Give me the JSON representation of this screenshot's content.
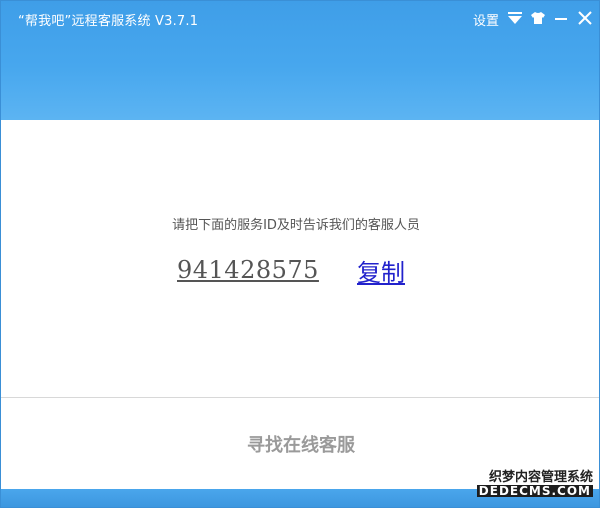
{
  "window": {
    "title": "“帮我吧”远程客服系统 V3.7.1",
    "settings_label": "设置",
    "controls": [
      "menu-dropdown-icon",
      "skin-shirt-icon",
      "minimize-icon",
      "close-icon"
    ]
  },
  "main": {
    "instruction": "请把下面的服务ID及时告诉我们的客服人员",
    "service_id": "941428575",
    "copy_label": "复制"
  },
  "footer": {
    "find_service": "寻找在线客服"
  },
  "watermark": {
    "line1": "织梦内容管理系统",
    "line2": "DEDECMS.COM"
  },
  "colors": {
    "header_top": "#3f9ee8",
    "header_bottom": "#5cb4f2",
    "link": "#2222cc",
    "text": "#555555"
  }
}
